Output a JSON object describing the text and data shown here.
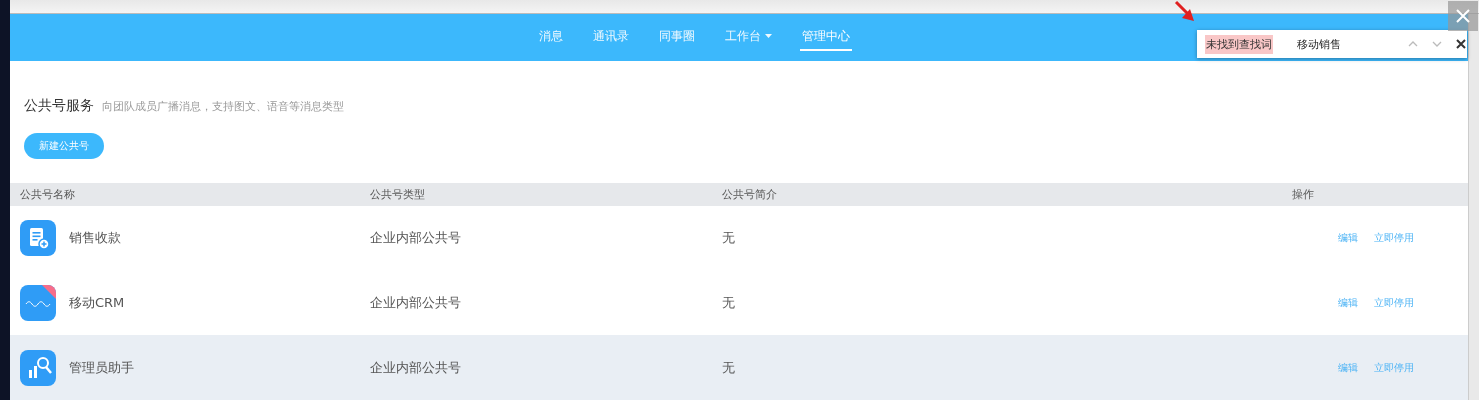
{
  "nav": {
    "items": [
      {
        "label": "消息",
        "selected": false,
        "dropdown": false
      },
      {
        "label": "通讯录",
        "selected": false,
        "dropdown": false
      },
      {
        "label": "同事圈",
        "selected": false,
        "dropdown": false
      },
      {
        "label": "工作台",
        "selected": false,
        "dropdown": true
      },
      {
        "label": "管理中心",
        "selected": true,
        "dropdown": false
      }
    ]
  },
  "find_bar": {
    "status": "未找到查找词",
    "value": "移动销售"
  },
  "section": {
    "title": "公共号服务",
    "subtitle": "向团队成员广播消息，支持图文、语音等消息类型",
    "button": "新建公共号"
  },
  "table": {
    "columns": [
      "公共号名称",
      "公共号类型",
      "公共号简介",
      "操作"
    ],
    "rows": [
      {
        "kind": "receipt",
        "name": "销售收款",
        "type": "企业内部公共号",
        "description": "无",
        "actions": [
          "编辑",
          "立即停用"
        ],
        "highlighted": false
      },
      {
        "kind": "crm",
        "name": "移动CRM",
        "type": "企业内部公共号",
        "description": "无",
        "actions": [
          "编辑",
          "立即停用"
        ],
        "highlighted": false
      },
      {
        "kind": "admin",
        "name": "管理员助手",
        "type": "企业内部公共号",
        "description": "无",
        "actions": [
          "编辑",
          "立即停用"
        ],
        "highlighted": true
      }
    ]
  }
}
